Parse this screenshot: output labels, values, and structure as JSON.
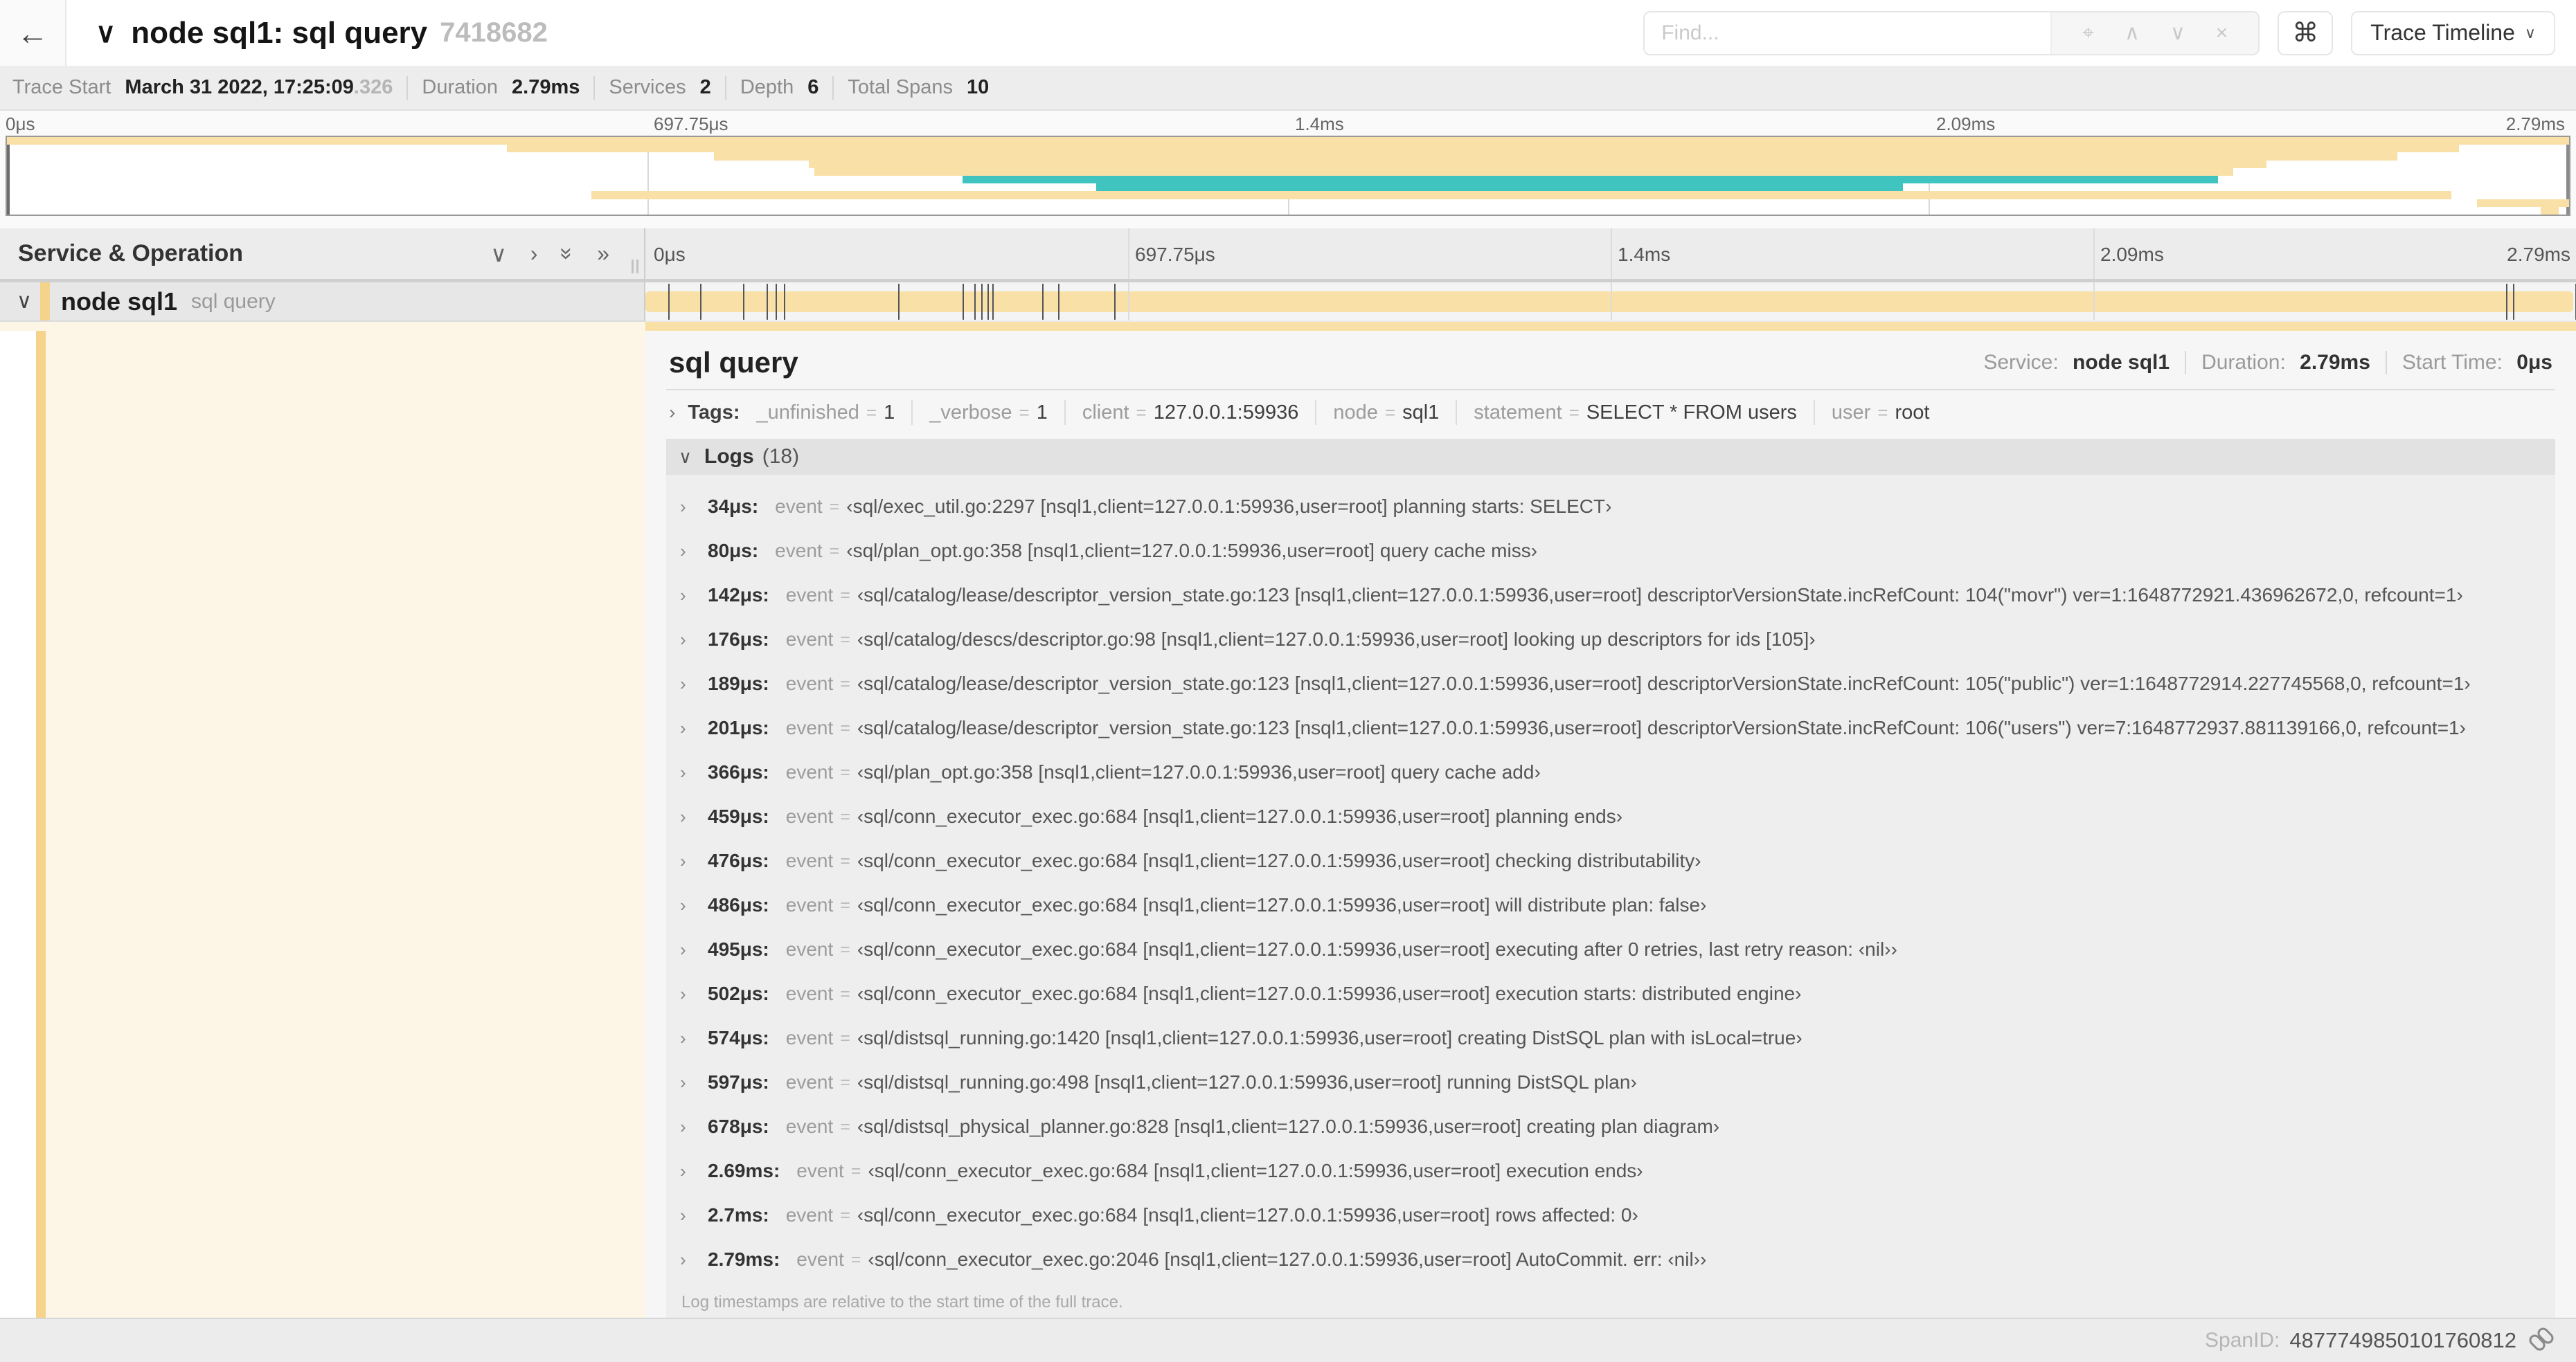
{
  "icons": {
    "back": "←",
    "chevron_down": "∨",
    "chevron_up": "∧",
    "chevron_right": "›",
    "double_chevron_right": "»",
    "crosshair": "⌖",
    "close": "×",
    "command": "⌘"
  },
  "colors": {
    "tan": "#f8e0a6",
    "teal": "#40c4c0",
    "strip": "#f5d38b",
    "cream": "#fdf6e7"
  },
  "header": {
    "title": "node sql1: sql query",
    "trace_id": "7418682",
    "find_placeholder": "Find...",
    "view_selector": "Trace Timeline"
  },
  "summary": {
    "items": [
      {
        "label": "Trace Start",
        "value": "March 31 2022, 17:25:09",
        "value_suffix": ".326"
      },
      {
        "label": "Duration",
        "value": "2.79ms"
      },
      {
        "label": "Services",
        "value": "2"
      },
      {
        "label": "Depth",
        "value": "6"
      },
      {
        "label": "Total Spans",
        "value": "10"
      }
    ]
  },
  "minimap": {
    "ticks": [
      "0μs",
      "697.75μs",
      "1.4ms",
      "2.09ms",
      "2.79ms"
    ],
    "spans": [
      {
        "start": 0,
        "end": 100,
        "color": "tan"
      },
      {
        "start": 19.5,
        "end": 95.7,
        "color": "tan"
      },
      {
        "start": 27.6,
        "end": 93.3,
        "color": "tan"
      },
      {
        "start": 31.3,
        "end": 88.2,
        "color": "tan"
      },
      {
        "start": 31.5,
        "end": 86.9,
        "color": "tan"
      },
      {
        "start": 37.3,
        "end": 86.3,
        "color": "teal"
      },
      {
        "start": 42.5,
        "end": 74.0,
        "color": "teal"
      },
      {
        "start": 22.8,
        "end": 95.4,
        "color": "tan"
      },
      {
        "start": 96.4,
        "end": 100,
        "color": "tan"
      },
      {
        "start": 98.9,
        "end": 99.6,
        "color": "tan"
      }
    ]
  },
  "timeline": {
    "left_header": "Service & Operation",
    "total_us": 2790,
    "row": {
      "service": "node sql1",
      "operation": "sql query"
    }
  },
  "detail": {
    "title": "sql query",
    "meta": [
      {
        "label": "Service:",
        "value": "node sql1"
      },
      {
        "label": "Duration:",
        "value": "2.79ms"
      },
      {
        "label": "Start Time:",
        "value": "0μs"
      }
    ],
    "tags_label": "Tags:",
    "tags": [
      {
        "key": "_unfinished",
        "value": "1"
      },
      {
        "key": "_verbose",
        "value": "1"
      },
      {
        "key": "client",
        "value": "127.0.0.1:59936"
      },
      {
        "key": "node",
        "value": "sql1"
      },
      {
        "key": "statement",
        "value": "SELECT * FROM users"
      },
      {
        "key": "user",
        "value": "root"
      }
    ],
    "logs_label": "Logs",
    "logs_count": "(18)",
    "logs": [
      {
        "t_us": 34,
        "time": "34μs:",
        "key": "event",
        "value": "‹sql/exec_util.go:2297 [nsql1,client=127.0.0.1:59936,user=root] planning starts: SELECT›"
      },
      {
        "t_us": 80,
        "time": "80μs:",
        "key": "event",
        "value": "‹sql/plan_opt.go:358 [nsql1,client=127.0.0.1:59936,user=root] query cache miss›"
      },
      {
        "t_us": 142,
        "time": "142μs:",
        "key": "event",
        "value": "‹sql/catalog/lease/descriptor_version_state.go:123 [nsql1,client=127.0.0.1:59936,user=root] descriptorVersionState.incRefCount: 104(\"movr\") ver=1:1648772921.436962672,0, refcount=1›"
      },
      {
        "t_us": 176,
        "time": "176μs:",
        "key": "event",
        "value": "‹sql/catalog/descs/descriptor.go:98 [nsql1,client=127.0.0.1:59936,user=root] looking up descriptors for ids [105]›"
      },
      {
        "t_us": 189,
        "time": "189μs:",
        "key": "event",
        "value": "‹sql/catalog/lease/descriptor_version_state.go:123 [nsql1,client=127.0.0.1:59936,user=root] descriptorVersionState.incRefCount: 105(\"public\") ver=1:1648772914.227745568,0, refcount=1›"
      },
      {
        "t_us": 201,
        "time": "201μs:",
        "key": "event",
        "value": "‹sql/catalog/lease/descriptor_version_state.go:123 [nsql1,client=127.0.0.1:59936,user=root] descriptorVersionState.incRefCount: 106(\"users\") ver=7:1648772937.881139166,0, refcount=1›"
      },
      {
        "t_us": 366,
        "time": "366μs:",
        "key": "event",
        "value": "‹sql/plan_opt.go:358 [nsql1,client=127.0.0.1:59936,user=root] query cache add›"
      },
      {
        "t_us": 459,
        "time": "459μs:",
        "key": "event",
        "value": "‹sql/conn_executor_exec.go:684 [nsql1,client=127.0.0.1:59936,user=root] planning ends›"
      },
      {
        "t_us": 476,
        "time": "476μs:",
        "key": "event",
        "value": "‹sql/conn_executor_exec.go:684 [nsql1,client=127.0.0.1:59936,user=root] checking distributability›"
      },
      {
        "t_us": 486,
        "time": "486μs:",
        "key": "event",
        "value": "‹sql/conn_executor_exec.go:684 [nsql1,client=127.0.0.1:59936,user=root] will distribute plan: false›"
      },
      {
        "t_us": 495,
        "time": "495μs:",
        "key": "event",
        "value": "‹sql/conn_executor_exec.go:684 [nsql1,client=127.0.0.1:59936,user=root] executing after 0 retries, last retry reason: ‹nil››"
      },
      {
        "t_us": 502,
        "time": "502μs:",
        "key": "event",
        "value": "‹sql/conn_executor_exec.go:684 [nsql1,client=127.0.0.1:59936,user=root] execution starts: distributed engine›"
      },
      {
        "t_us": 574,
        "time": "574μs:",
        "key": "event",
        "value": "‹sql/distsql_running.go:1420 [nsql1,client=127.0.0.1:59936,user=root] creating DistSQL plan with isLocal=true›"
      },
      {
        "t_us": 597,
        "time": "597μs:",
        "key": "event",
        "value": "‹sql/distsql_running.go:498 [nsql1,client=127.0.0.1:59936,user=root] running DistSQL plan›"
      },
      {
        "t_us": 678,
        "time": "678μs:",
        "key": "event",
        "value": "‹sql/distsql_physical_planner.go:828 [nsql1,client=127.0.0.1:59936,user=root] creating plan diagram›"
      },
      {
        "t_us": 2690,
        "time": "2.69ms:",
        "key": "event",
        "value": "‹sql/conn_executor_exec.go:684 [nsql1,client=127.0.0.1:59936,user=root] execution ends›"
      },
      {
        "t_us": 2700,
        "time": "2.7ms:",
        "key": "event",
        "value": "‹sql/conn_executor_exec.go:684 [nsql1,client=127.0.0.1:59936,user=root] rows affected: 0›"
      },
      {
        "t_us": 2790,
        "time": "2.79ms:",
        "key": "event",
        "value": "‹sql/conn_executor_exec.go:2046 [nsql1,client=127.0.0.1:59936,user=root] AutoCommit. err: ‹nil››"
      }
    ],
    "logs_footnote": "Log timestamps are relative to the start time of the full trace.",
    "span_id_label": "SpanID:",
    "span_id": "4877749850101760812"
  }
}
